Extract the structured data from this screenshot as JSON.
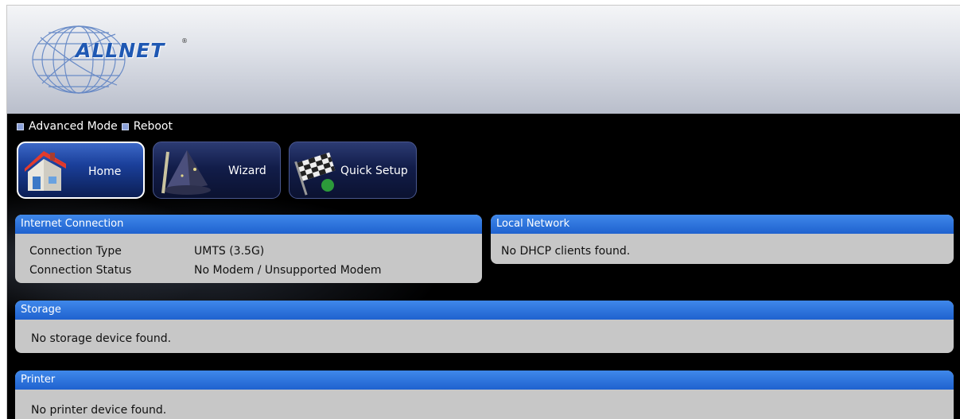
{
  "brand": {
    "logo_text": "ALLNET",
    "registered_mark": "®"
  },
  "top_links": {
    "advanced_mode": "Advanced Mode",
    "reboot": "Reboot"
  },
  "nav": {
    "home": "Home",
    "wizard": "Wizard",
    "quick_setup": "Quick Setup"
  },
  "internet_connection": {
    "title": "Internet Connection",
    "connection_type_label": "Connection Type",
    "connection_type_value": "UMTS (3.5G)",
    "connection_status_label": "Connection Status",
    "connection_status_value": "No Modem / Unsupported Modem"
  },
  "local_network": {
    "title": "Local Network",
    "message": "No DHCP clients found."
  },
  "storage": {
    "title": "Storage",
    "message": "No storage device found."
  },
  "printer": {
    "title": "Printer",
    "message": "No printer device found."
  },
  "colors": {
    "panel_header_blue": "#2a74de",
    "panel_body_gray": "#c7c7c7",
    "background_black": "#000000",
    "logo_blue": "#1f58b3"
  },
  "icons": [
    "house-icon",
    "wizard-hat-icon",
    "checkered-flag-icon",
    "globe-logo-icon"
  ]
}
